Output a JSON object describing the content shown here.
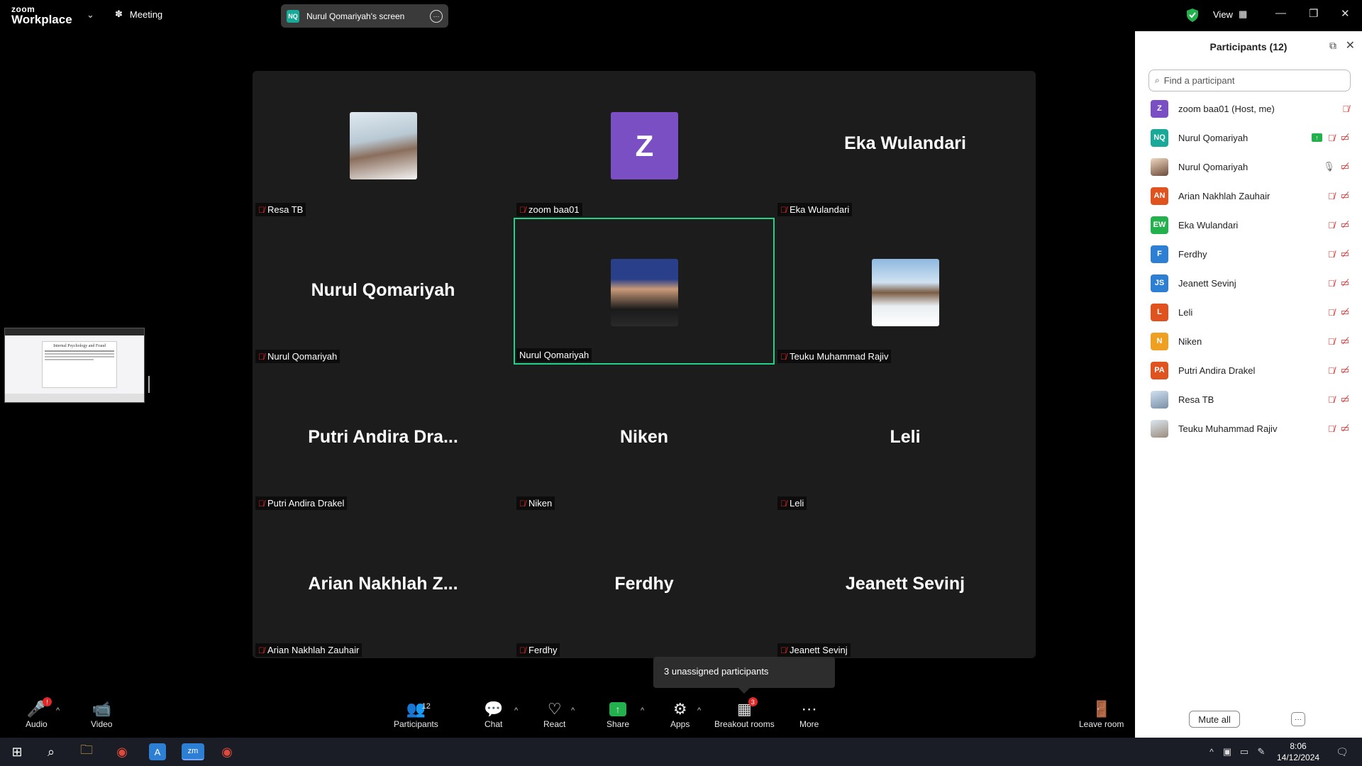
{
  "titlebar": {
    "logo_top": "zoom",
    "logo_bottom": "Workplace",
    "meeting_label": "Meeting",
    "screen_badge": "NQ",
    "screen_label": "Nurul Qomariyah's screen",
    "view_label": "View"
  },
  "tiles": [
    {
      "big": "",
      "label": "Resa TB",
      "avatar": "photo-man"
    },
    {
      "big": "",
      "label": "zoom baa01",
      "avatar": "Z"
    },
    {
      "big": "Eka Wulandari",
      "label": "Eka Wulandari"
    },
    {
      "big": "Nurul Qomariyah",
      "label": "Nurul Qomariyah"
    },
    {
      "big": "",
      "label": "Nurul Qomariyah",
      "avatar": "photo-woman",
      "active": true
    },
    {
      "big": "",
      "label": "Teuku Muhammad Rajiv",
      "avatar": "photo-snow"
    },
    {
      "big": "Putri Andira Dra...",
      "label": "Putri Andira Drakel"
    },
    {
      "big": "Niken",
      "label": "Niken"
    },
    {
      "big": "Leli",
      "label": "Leli"
    },
    {
      "big": "Arian Nakhlah Z...",
      "label": "Arian Nakhlah Zauhair"
    },
    {
      "big": "Ferdhy",
      "label": "Ferdhy"
    },
    {
      "big": "Jeanett Sevinj",
      "label": "Jeanett Sevinj"
    }
  ],
  "thumbnail": {
    "doc_title": "Internal Psychology and Fraud"
  },
  "tooltip": "3 unassigned participants",
  "toolbar": {
    "audio": "Audio",
    "audio_badge": "!",
    "video": "Video",
    "participants": "Participants",
    "participants_count": "12",
    "chat": "Chat",
    "react": "React",
    "share": "Share",
    "apps": "Apps",
    "breakout": "Breakout rooms",
    "breakout_badge": "3",
    "more": "More",
    "leave": "Leave room"
  },
  "panel": {
    "title": "Participants (12)",
    "search_placeholder": "Find a participant",
    "participants": [
      {
        "initials": "Z",
        "name": "zoom baa01 (Host, me)",
        "color": "#7a4fc4"
      },
      {
        "initials": "NQ",
        "name": "Nurul Qomariyah",
        "color": "#18a999"
      },
      {
        "initials": "",
        "name": "Nurul Qomariyah",
        "color": "photo"
      },
      {
        "initials": "AN",
        "name": "Arian Nakhlah Zauhair",
        "color": "#e0531f"
      },
      {
        "initials": "EW",
        "name": "Eka Wulandari",
        "color": "#23b14d"
      },
      {
        "initials": "F",
        "name": "Ferdhy",
        "color": "#2d7fd3"
      },
      {
        "initials": "JS",
        "name": "Jeanett Sevinj",
        "color": "#2d7fd3"
      },
      {
        "initials": "L",
        "name": "Leli",
        "color": "#e0531f"
      },
      {
        "initials": "N",
        "name": "Niken",
        "color": "#f0a020"
      },
      {
        "initials": "PA",
        "name": "Putri Andira Drakel",
        "color": "#e0531f"
      },
      {
        "initials": "",
        "name": "Resa TB",
        "color": "photo"
      },
      {
        "initials": "",
        "name": "Teuku Muhammad Rajiv",
        "color": "photo"
      }
    ],
    "mute_all": "Mute all"
  },
  "taskbar": {
    "time": "8:06",
    "date": "14/12/2024"
  }
}
